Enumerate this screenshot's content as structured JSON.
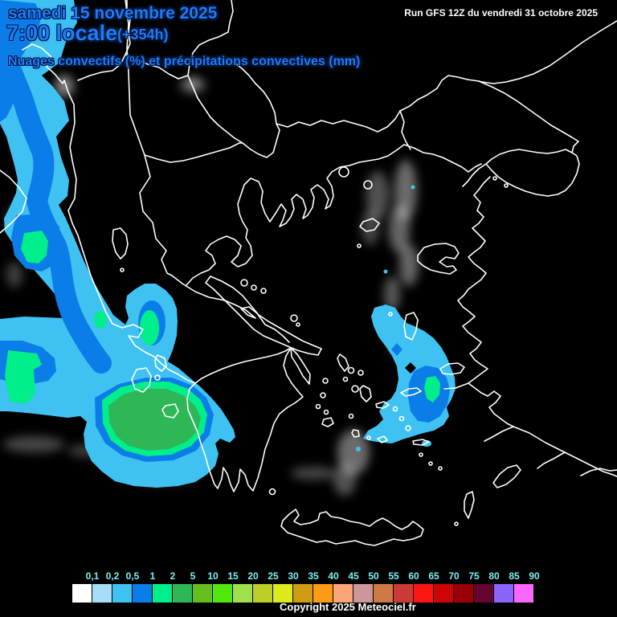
{
  "header": {
    "date_line": "samedi 15 novembre 2025",
    "time_line": "7:00 locale",
    "forecast_offset": "(+354h)",
    "run_info": "Run GFS 12Z du vendredi 31 octobre 2025",
    "subtitle": "Nuages convectifs (%) et précipitations convectives (mm)"
  },
  "footer": {
    "copyright": "Copyright 2025 Meteociel.fr"
  },
  "legend": {
    "values": [
      "0,1",
      "0,2",
      "0,5",
      "1",
      "2",
      "5",
      "10",
      "15",
      "20",
      "25",
      "30",
      "35",
      "40",
      "45",
      "50",
      "55",
      "60",
      "65",
      "70",
      "75",
      "80",
      "85",
      "90"
    ],
    "colors": [
      "#ffffff",
      "#a6def8",
      "#3fc2f2",
      "#0b7de9",
      "#00ef8a",
      "#2eb757",
      "#64be1e",
      "#52e80b",
      "#a0e04d",
      "#bcce28",
      "#dcea1e",
      "#cf9c14",
      "#fb9b16",
      "#fba578",
      "#cb9799",
      "#cd7a44",
      "#cc3a35",
      "#fb1511",
      "#cd0506",
      "#970005",
      "#650532",
      "#8a63fb",
      "#fb66fb"
    ],
    "label_color": "#7df2e0"
  },
  "map": {
    "background": "#000000",
    "coastline_color": "#ffffff",
    "cloud_color": "#ffffff",
    "precip_levels_shown": [
      {
        "threshold_mm": "0,2",
        "color": "#3fc2f2"
      },
      {
        "threshold_mm": "0,5",
        "color": "#0b7de9"
      },
      {
        "threshold_mm": "1",
        "color": "#00ef8a"
      },
      {
        "threshold_mm": "2",
        "color": "#2eb757"
      }
    ]
  },
  "colors": {
    "title_blue": "#1e7cf5",
    "text_white": "#ffffff"
  }
}
